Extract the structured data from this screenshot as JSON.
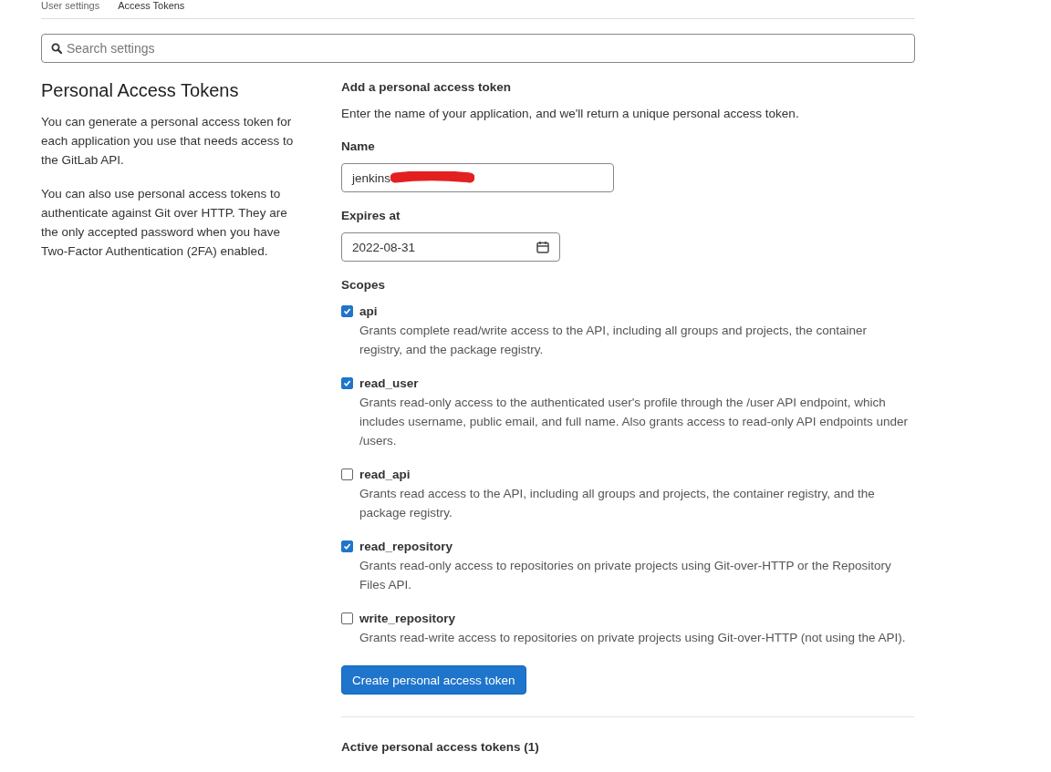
{
  "breadcrumb": [
    "User settings",
    "Access Tokens"
  ],
  "search": {
    "placeholder": "Search settings"
  },
  "intro": {
    "title": "Personal Access Tokens",
    "paragraphs": [
      "You can generate a personal access token for each application you use that needs access to the GitLab API.",
      "You can also use personal access tokens to authenticate against Git over HTTP. They are the only accepted password when you have Two-Factor Authentication (2FA) enabled."
    ]
  },
  "form": {
    "title": "Add a personal access token",
    "description": "Enter the name of your application, and we'll return a unique personal access token.",
    "name": {
      "label": "Name",
      "value": "jenkins",
      "redacted": true
    },
    "expires": {
      "label": "Expires at",
      "value": "2022-08-31"
    },
    "scopes_label": "Scopes",
    "scopes": [
      {
        "name": "api",
        "checked": true,
        "description": "Grants complete read/write access to the API, including all groups and projects, the container registry, and the package registry."
      },
      {
        "name": "read_user",
        "checked": true,
        "description": "Grants read-only access to the authenticated user's profile through the /user API endpoint, which includes username, public email, and full name. Also grants access to read-only API endpoints under /users."
      },
      {
        "name": "read_api",
        "checked": false,
        "description": "Grants read access to the API, including all groups and projects, the container registry, and the package registry."
      },
      {
        "name": "read_repository",
        "checked": true,
        "description": "Grants read-only access to repositories on private projects using Git-over-HTTP or the Repository Files API."
      },
      {
        "name": "write_repository",
        "checked": false,
        "description": "Grants read-write access to repositories on private projects using Git-over-HTTP (not using the API)."
      }
    ],
    "submit": "Create personal access token"
  },
  "active_title": "Active personal access tokens (1)"
}
